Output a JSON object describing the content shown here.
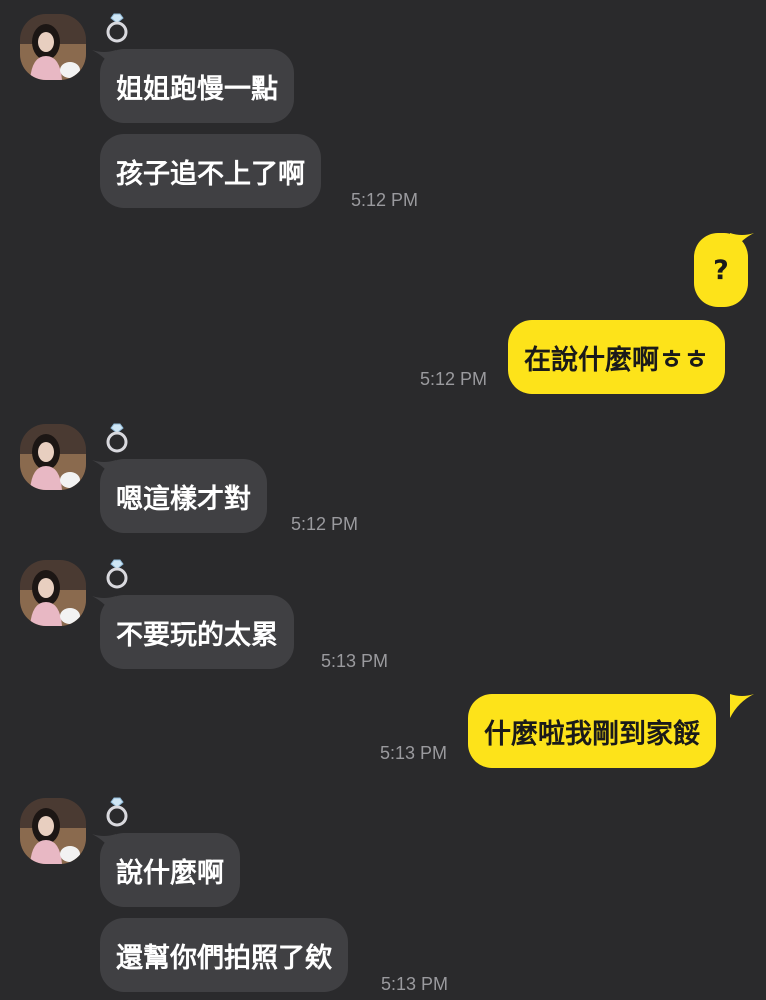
{
  "theme": {
    "background": "#2a2a2c",
    "incoming_bubble": "#404043",
    "outgoing_bubble": "#fde31a",
    "timestamp_color": "#9a9a9e"
  },
  "messages": [
    {
      "direction": "incoming",
      "sender_badge_icon": "diamond-ring-icon",
      "bubbles": [
        "姐姐跑慢一點",
        "孩子追不上了啊"
      ],
      "time": "5:12 PM"
    },
    {
      "direction": "outgoing",
      "bubbles": [
        "?",
        "在說什麼啊ㅎㅎ"
      ],
      "time": "5:12 PM"
    },
    {
      "direction": "incoming",
      "sender_badge_icon": "diamond-ring-icon",
      "bubbles": [
        "嗯這樣才對"
      ],
      "time": "5:12 PM"
    },
    {
      "direction": "incoming",
      "sender_badge_icon": "diamond-ring-icon",
      "bubbles": [
        "不要玩的太累"
      ],
      "time": "5:13 PM"
    },
    {
      "direction": "outgoing",
      "bubbles": [
        "什麼啦我剛到家餒"
      ],
      "time": "5:13 PM"
    },
    {
      "direction": "incoming",
      "sender_badge_icon": "diamond-ring-icon",
      "bubbles": [
        "說什麼啊",
        "還幫你們拍照了欸"
      ],
      "time": "5:13 PM"
    }
  ]
}
